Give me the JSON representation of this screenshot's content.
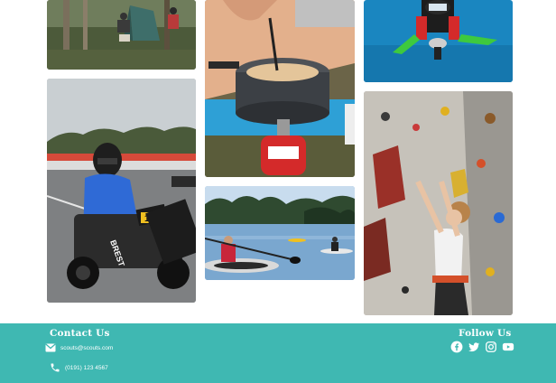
{
  "gallery": {
    "images": [
      {
        "name": "camping-photo",
        "subject": "scouts pitching a tent in a forest"
      },
      {
        "name": "cooking-photo",
        "subject": "camping stove cooking food"
      },
      {
        "name": "diving-photo",
        "subject": "scuba diver underwater"
      },
      {
        "name": "karting-photo",
        "subject": "go-kart driver",
        "kart_number": "14",
        "suit_text": "BREST"
      },
      {
        "name": "kayaking-photo",
        "subject": "kayakers on a lake"
      },
      {
        "name": "climbing-photo",
        "subject": "child on indoor climbing wall"
      }
    ]
  },
  "footer": {
    "background_color": "#3fb8b2",
    "contact": {
      "heading": "Contact Us",
      "email": "scouts@scouts.com",
      "email_icon": "envelope-icon",
      "phone": "(0191) 123 4567",
      "phone_icon": "phone-icon"
    },
    "follow": {
      "heading": "Follow Us",
      "icons": [
        "facebook-icon",
        "twitter-icon",
        "instagram-icon",
        "youtube-icon"
      ]
    }
  }
}
